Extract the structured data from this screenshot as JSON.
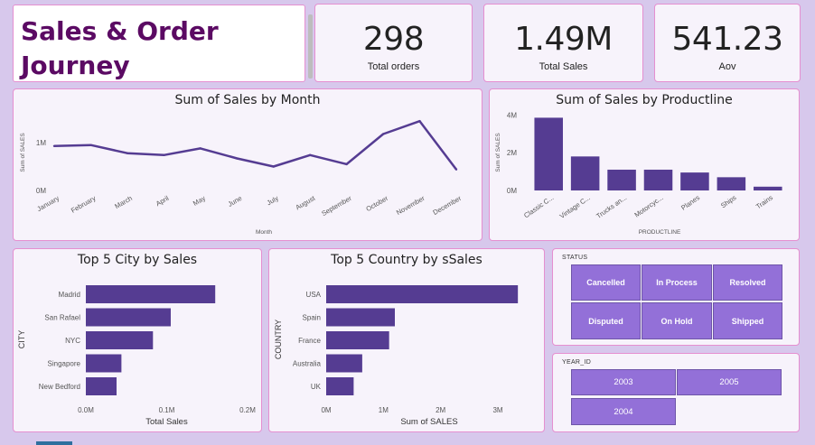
{
  "dashboard_title": "Sales & Order Journey Dashboard",
  "kpis": [
    {
      "value": "298",
      "label": "Total orders"
    },
    {
      "value": "1.49M",
      "label": "Total Sales"
    },
    {
      "value": "541.23",
      "label": "Aov"
    }
  ],
  "colors": {
    "accent": "#553c92",
    "tile": "#9370d8",
    "title": "#5b0a63",
    "border": "#e58fd0",
    "background": "#d7c8ec"
  },
  "chart_data": [
    {
      "type": "line",
      "title": "Sum of Sales by Month",
      "xlabel": "Month",
      "ylabel": "Sum of SALES",
      "categories": [
        "January",
        "February",
        "March",
        "April",
        "May",
        "June",
        "July",
        "August",
        "September",
        "October",
        "November",
        "December"
      ],
      "values": [
        0.93,
        0.95,
        0.78,
        0.74,
        0.88,
        0.67,
        0.5,
        0.74,
        0.55,
        1.18,
        1.45,
        0.44
      ],
      "y_tick_labels": [
        "0M",
        "1M"
      ],
      "y_ticks": [
        0,
        1
      ],
      "ylim": [
        0,
        1.7
      ]
    },
    {
      "type": "bar",
      "title": "Sum of Sales by Productline",
      "xlabel": "PRODUCTLINE",
      "ylabel": "Sum of SALES",
      "categories": [
        "Classic C...",
        "Vintage C...",
        "Trucks an...",
        "Motorcyc...",
        "Planes",
        "Ships",
        "Trains"
      ],
      "values": [
        3.85,
        1.8,
        1.1,
        1.1,
        0.95,
        0.7,
        0.2
      ],
      "y_tick_labels": [
        "0M",
        "2M",
        "4M"
      ],
      "y_ticks": [
        0,
        2,
        4
      ],
      "ylim": [
        0,
        4.3
      ]
    },
    {
      "type": "bar",
      "orientation": "horizontal",
      "title": "Top 5 City by Sales",
      "xlabel": "Total Sales",
      "ylabel": "CITY",
      "categories": [
        "Madrid",
        "San Rafael",
        "NYC",
        "Singapore",
        "New Bedford"
      ],
      "values": [
        0.16,
        0.105,
        0.083,
        0.044,
        0.038
      ],
      "x_tick_labels": [
        "0.0M",
        "0.1M",
        "0.2M"
      ],
      "x_ticks": [
        0,
        0.1,
        0.2
      ],
      "xlim": [
        0,
        0.2
      ]
    },
    {
      "type": "bar",
      "orientation": "horizontal",
      "title": "Top 5 Country by sSales",
      "xlabel": "Sum of SALES",
      "ylabel": "COUNTRY",
      "categories": [
        "USA",
        "Spain",
        "France",
        "Australia",
        "UK"
      ],
      "values": [
        3.35,
        1.2,
        1.1,
        0.63,
        0.48
      ],
      "x_tick_labels": [
        "0M",
        "1M",
        "2M",
        "3M"
      ],
      "x_ticks": [
        0,
        1,
        2,
        3
      ],
      "xlim": [
        0,
        3.6
      ]
    }
  ],
  "status_slicer": {
    "header": "STATUS",
    "options": [
      "Cancelled",
      "In Process",
      "Resolved",
      "Disputed",
      "On Hold",
      "Shipped"
    ]
  },
  "year_slicer": {
    "header": "YEAR_ID",
    "options": [
      "2003",
      "2005",
      "2004"
    ]
  }
}
